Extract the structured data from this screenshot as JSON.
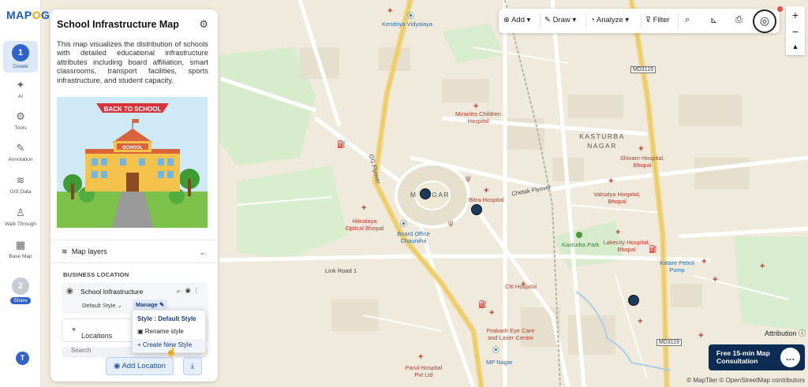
{
  "app": {
    "logo": "MAPOG",
    "logo_parts": [
      "MAP",
      "O",
      "G"
    ]
  },
  "rail": {
    "items": [
      {
        "label": "Create",
        "step": "1",
        "icon": "step-icon"
      },
      {
        "label": "AI",
        "icon": "ai-icon"
      },
      {
        "label": "Tools",
        "icon": "tools-icon"
      },
      {
        "label": "Annotation",
        "icon": "annotation-icon"
      },
      {
        "label": "GIS Data",
        "icon": "layers-icon"
      },
      {
        "label": "Walk Through",
        "icon": "walk-icon"
      },
      {
        "label": "Base Map",
        "icon": "basemap-icon"
      }
    ],
    "share": {
      "step": "2",
      "label": "Share"
    },
    "avatar": "T"
  },
  "panel": {
    "title": "School Infrastructure Map",
    "description": "This map visualizes the distribution of schools with detailed educational infrastructure attributes including board affiliation, smart classrooms, transport facilities, sports infrastructure, and student capacity.",
    "illustration": {
      "banner": "BACK TO SCHOOL",
      "sign": "SCHOOL"
    },
    "map_layers_label": "Map layers",
    "section_label": "BUSINESS LOCATION",
    "layer": {
      "name": "School Infrastructure",
      "style_select": "Default Style",
      "manage_label": "Manage"
    },
    "locations_label": "Locations",
    "search_placeholder": "Search",
    "add_location_label": "Add Location"
  },
  "style_menu": {
    "header": "Style : Default Style",
    "rename": "Rename style",
    "create": "+ Create New Style"
  },
  "toolbar": {
    "add": "Add",
    "draw": "Draw",
    "analyze": "Analyze",
    "filter": "Filter"
  },
  "zoom": {
    "in": "+",
    "out": "−",
    "north": "▲"
  },
  "map": {
    "labels": [
      {
        "text": "Kendriya Vidyalaya",
        "kind": "blue"
      },
      {
        "text": "Miracles Children Hospital",
        "kind": "red"
      },
      {
        "text": "KASTURBA NAGAR",
        "kind": "gray"
      },
      {
        "text": "Shivam Hospital, Bhopal",
        "kind": "red"
      },
      {
        "text": "Vatsalya Hospital, Bhopal",
        "kind": "red"
      },
      {
        "text": "Chetak Flyover",
        "kind": "road"
      },
      {
        "text": "Bitra Hospital",
        "kind": "red"
      },
      {
        "text": "Himalaya Optical Bhopal",
        "kind": "red"
      },
      {
        "text": "Board Office Chauraha",
        "kind": "blue"
      },
      {
        "text": "Kasturba Park",
        "kind": "green"
      },
      {
        "text": "Lakecity Hospital, Bhopal",
        "kind": "red"
      },
      {
        "text": "Katare Petrol Pump",
        "kind": "blue"
      },
      {
        "text": "Link Road 1",
        "kind": "road"
      },
      {
        "text": "Citi Hospital",
        "kind": "red"
      },
      {
        "text": "Prakash Eye Care and Laser Centre",
        "kind": "red"
      },
      {
        "text": "MP Nagar",
        "kind": "blue"
      },
      {
        "text": "Parul Hospital Pvt Ltd",
        "kind": "red"
      },
      {
        "text": "GG Flyover",
        "kind": "road"
      },
      {
        "text": "M NAGAR",
        "kind": "gray"
      }
    ],
    "road_shields": [
      "MD3119",
      "MD3119"
    ]
  },
  "attribution_label": "Attribution",
  "consultation": "Free 15-min Map Consultation",
  "copyright": "© MapTiler © OpenStreetMap contributors",
  "colors": {
    "accent": "#2f63c9",
    "marker": "#1c3a5c",
    "hospital": "#c0392b",
    "consult_bg": "#0d2c54"
  }
}
